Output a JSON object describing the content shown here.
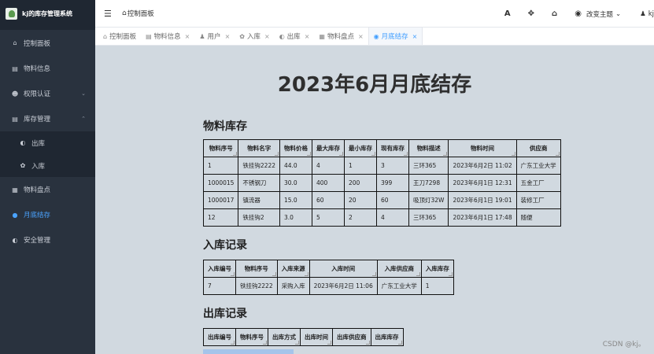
{
  "app": {
    "title": "kj的库存管理系统"
  },
  "sidebar": {
    "items": [
      {
        "label": "控制面板",
        "icon": "home-icon"
      },
      {
        "label": "物料信息",
        "icon": "truck-icon"
      },
      {
        "label": "权限认证",
        "icon": "users-key-icon"
      },
      {
        "label": "库存管理",
        "icon": "archive-icon"
      },
      {
        "label": "出库",
        "icon": "pie-icon"
      },
      {
        "label": "入库",
        "icon": "puzzle-icon"
      },
      {
        "label": "物料盘点",
        "icon": "truck-icon"
      },
      {
        "label": "月底结存",
        "icon": "dot-icon"
      },
      {
        "label": "安全管理",
        "icon": "shield-icon"
      }
    ]
  },
  "header": {
    "breadcrumb": "控制面板",
    "theme_label": "改变主题",
    "user_label": "kj"
  },
  "tabs": [
    {
      "label": "控制面板"
    },
    {
      "label": "物料信息"
    },
    {
      "label": "用户"
    },
    {
      "label": "入库"
    },
    {
      "label": "出库"
    },
    {
      "label": "物料盘点"
    },
    {
      "label": "月底结存"
    }
  ],
  "main": {
    "title": "2023年6月月底结存",
    "inventory": {
      "title": "物料库存",
      "headers": [
        "物料序号",
        "物料名字",
        "物料价格",
        "最大库存",
        "最小库存",
        "现有库存",
        "物料描述",
        "物料时间",
        "供应商"
      ],
      "rows": [
        [
          "1",
          "铁挂钩2222",
          "44.0",
          "4",
          "1",
          "3",
          "三环365",
          "2023年6月2日 11:02",
          "广东工业大学"
        ],
        [
          "1000015",
          "不锈钢刀",
          "30.0",
          "400",
          "200",
          "399",
          "王刀7298",
          "2023年6月1日 12:31",
          "五金工厂"
        ],
        [
          "1000017",
          "镇流器",
          "15.0",
          "60",
          "20",
          "60",
          "吸顶灯32W",
          "2023年6月1日 19:01",
          "装修工厂"
        ],
        [
          "12",
          "铁挂钩2",
          "3.0",
          "5",
          "2",
          "4",
          "三环365",
          "2023年6月1日 17:48",
          "随便"
        ]
      ]
    },
    "inbound": {
      "title": "入库记录",
      "headers": [
        "入库编号",
        "物料序号",
        "入库来源",
        "入库时间",
        "入库供应商",
        "入库库存"
      ],
      "rows": [
        [
          "7",
          "铁挂钩2222",
          "采购入库",
          "2023年6月2日 11:06",
          "广东工业大学",
          "1"
        ]
      ]
    },
    "outbound": {
      "title": "出库记录",
      "headers": [
        "出库编号",
        "物料序号",
        "出库方式",
        "出库时间",
        "出库供应商",
        "出库库存"
      ],
      "rows": []
    }
  },
  "watermark": "CSDN @kj。"
}
